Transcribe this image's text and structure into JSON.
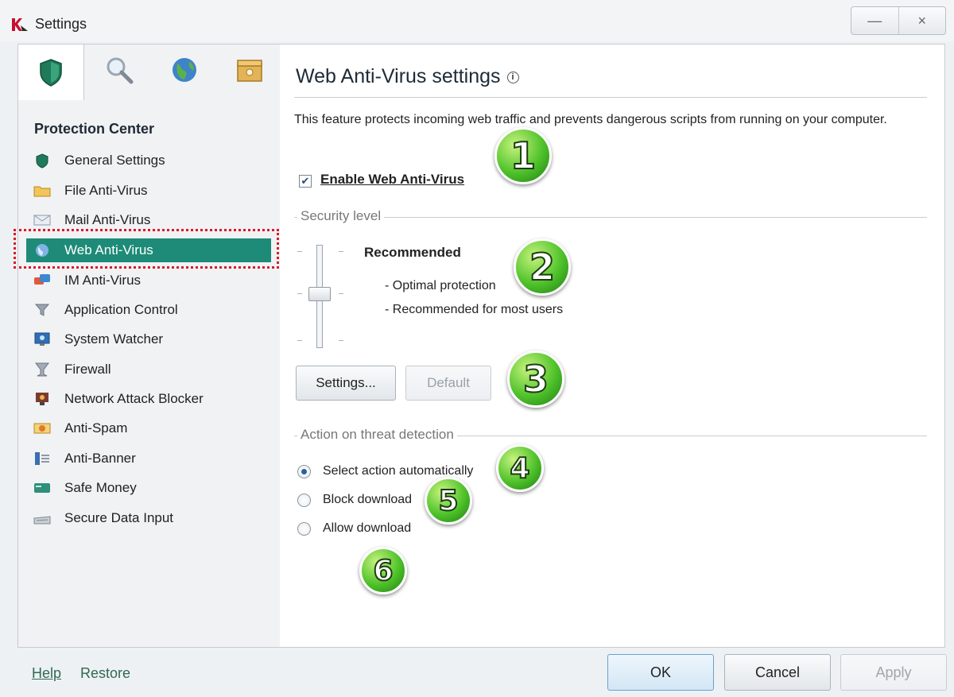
{
  "window": {
    "title": "Settings",
    "minimize_label": "—",
    "close_label": "×"
  },
  "tabs": [
    {
      "icon": "shield-icon"
    },
    {
      "icon": "magnifier-icon"
    },
    {
      "icon": "globe-icon"
    },
    {
      "icon": "box-icon"
    }
  ],
  "sidebar": {
    "title": "Protection Center",
    "items": [
      {
        "label": "General Settings",
        "icon": "shield-icon"
      },
      {
        "label": "File Anti-Virus",
        "icon": "folder-icon"
      },
      {
        "label": "Mail Anti-Virus",
        "icon": "mail-icon"
      },
      {
        "label": "Web Anti-Virus",
        "icon": "globe-icon",
        "selected": true
      },
      {
        "label": "IM Anti-Virus",
        "icon": "chat-icon"
      },
      {
        "label": "Application Control",
        "icon": "funnel-icon"
      },
      {
        "label": "System Watcher",
        "icon": "monitor-icon"
      },
      {
        "label": "Firewall",
        "icon": "firewall-icon"
      },
      {
        "label": "Network Attack Blocker",
        "icon": "network-blocker-icon"
      },
      {
        "label": "Anti-Spam",
        "icon": "spam-icon"
      },
      {
        "label": "Anti-Banner",
        "icon": "banner-icon"
      },
      {
        "label": "Safe Money",
        "icon": "card-icon"
      },
      {
        "label": "Secure Data Input",
        "icon": "keyboard-icon"
      }
    ]
  },
  "main": {
    "title": "Web Anti-Virus settings",
    "info_glyph": "i",
    "description": "This feature protects incoming web traffic and prevents dangerous scripts from running on your computer.",
    "enable_label": "Enable Web Anti-Virus",
    "enable_checked": true,
    "security_group": "Security level",
    "level_name": "Recommended",
    "level_points": [
      "- Optimal protection",
      "- Recommended for most users"
    ],
    "settings_button": "Settings...",
    "default_button": "Default",
    "action_group": "Action on threat detection",
    "actions": [
      {
        "label": "Select action automatically",
        "checked": true
      },
      {
        "label": "Block download",
        "checked": false
      },
      {
        "label": "Allow download",
        "checked": false
      }
    ]
  },
  "callouts": [
    "1",
    "2",
    "3",
    "4",
    "5",
    "6"
  ],
  "footer": {
    "help": "Help",
    "restore": "Restore",
    "ok": "OK",
    "cancel": "Cancel",
    "apply": "Apply"
  },
  "colors": {
    "selected_item": "#1e8a78",
    "selection_outline": "#d81b2a",
    "callout_green": "#4fc22a",
    "link_green": "#2f6a52"
  }
}
